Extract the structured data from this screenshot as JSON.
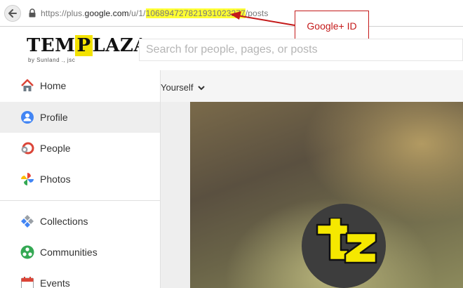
{
  "browser": {
    "url_prefix": "https://plus.",
    "url_host": "google.com",
    "url_path_pre": "/u/1/",
    "url_id": "106894727821931023277",
    "url_suffix": "/posts"
  },
  "annotation": {
    "label": "Google+ ID",
    "color": "#c41a1a"
  },
  "header": {
    "logo_pre": "TEM",
    "logo_mark": "P",
    "logo_post": "LAZA",
    "logo_sub": "by Sunland ., jsc",
    "search_placeholder": "Search for people, pages, or posts"
  },
  "sidebar": {
    "items": [
      {
        "label": "Home",
        "icon": "home-icon"
      },
      {
        "label": "Profile",
        "icon": "profile-icon",
        "active": true
      },
      {
        "label": "People",
        "icon": "people-icon"
      },
      {
        "label": "Photos",
        "icon": "photos-icon"
      },
      {
        "label": "Collections",
        "icon": "collections-icon"
      },
      {
        "label": "Communities",
        "icon": "communities-icon"
      },
      {
        "label": "Events",
        "icon": "events-icon"
      }
    ]
  },
  "content": {
    "filter_label": "Yourself"
  },
  "colors": {
    "highlight": "#ffff33",
    "brand_yellow": "#f3e200",
    "active_bg": "#eeeeee"
  }
}
